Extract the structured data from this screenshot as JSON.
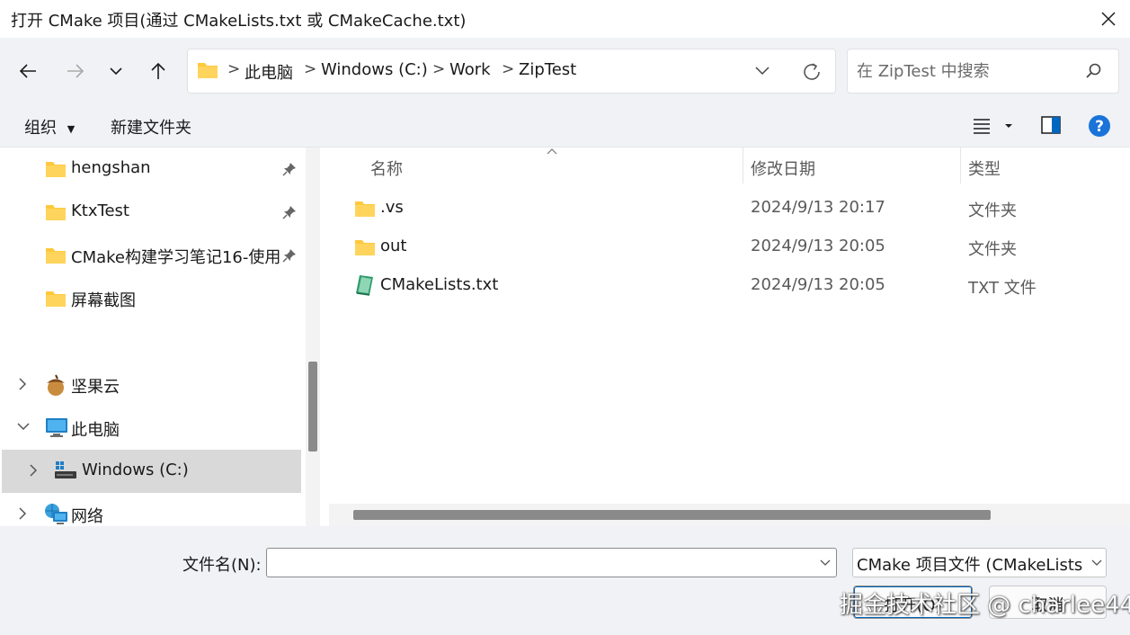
{
  "window": {
    "title": "打开 CMake 项目(通过 CMakeLists.txt 或 CMakeCache.txt)"
  },
  "address": {
    "crumbs": [
      "此电脑",
      "Windows (C:)",
      "Work",
      "ZipTest"
    ],
    "separator": ">"
  },
  "search": {
    "placeholder": "在 ZipTest 中搜索"
  },
  "commandbar": {
    "organize": "组织",
    "new_folder": "新建文件夹"
  },
  "sidebar": {
    "pinned": [
      {
        "label": "hengshan"
      },
      {
        "label": "KtxTest"
      },
      {
        "label": "CMake构建学习笔记16-使用"
      },
      {
        "label": "屏幕截图"
      }
    ],
    "tree": [
      {
        "label": "坚果云"
      },
      {
        "label": "此电脑"
      },
      {
        "label": "Windows (C:)"
      },
      {
        "label": "网络"
      }
    ]
  },
  "filelist": {
    "columns": {
      "name": "名称",
      "date": "修改日期",
      "type": "类型"
    },
    "rows": [
      {
        "name": ".vs",
        "date": "2024/9/13 20:17",
        "type": "文件夹",
        "icon": "folder-icon"
      },
      {
        "name": "out",
        "date": "2024/9/13 20:05",
        "type": "文件夹",
        "icon": "folder-icon"
      },
      {
        "name": "CMakeLists.txt",
        "date": "2024/9/13 20:05",
        "type": "TXT 文件",
        "icon": "text-file-icon"
      }
    ]
  },
  "footer": {
    "filename_label": "文件名(N):",
    "filename_value": "",
    "filetype": "CMake 项目文件 (CMakeLists",
    "open_button": "打开(O)",
    "cancel_button": "取消"
  },
  "watermark": "掘金技术社区 @ charlee44",
  "colors": {
    "accent": "#0067c0",
    "folder": "#ffc83d",
    "help": "#1a73d8",
    "selection": "#d9d9d9",
    "chrome_bg": "#f0f2f6"
  }
}
